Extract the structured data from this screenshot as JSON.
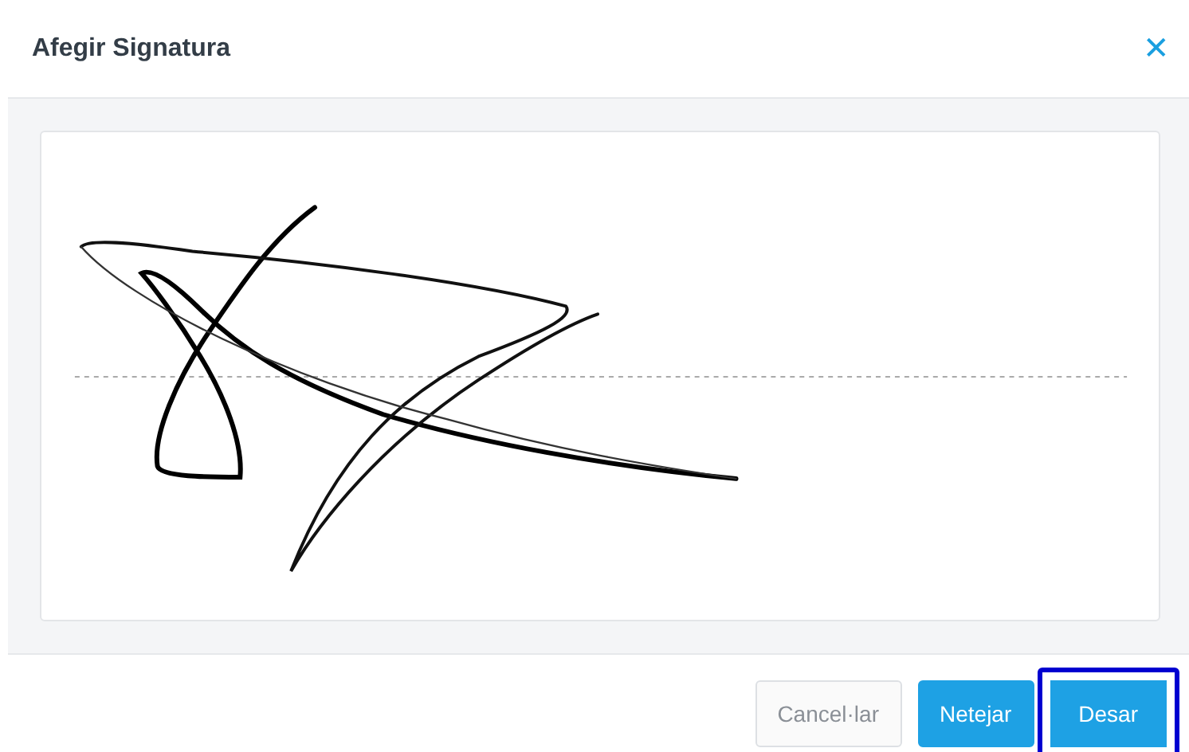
{
  "dialog": {
    "title": "Afegir Signatura",
    "close": "✕"
  },
  "buttons": [
    {
      "label": "Cancel·lar",
      "kind": "secondary",
      "focused": false
    },
    {
      "label": "Netejar",
      "kind": "primary",
      "focused": false
    },
    {
      "label": "Desar",
      "kind": "primary",
      "focused": true
    }
  ]
}
